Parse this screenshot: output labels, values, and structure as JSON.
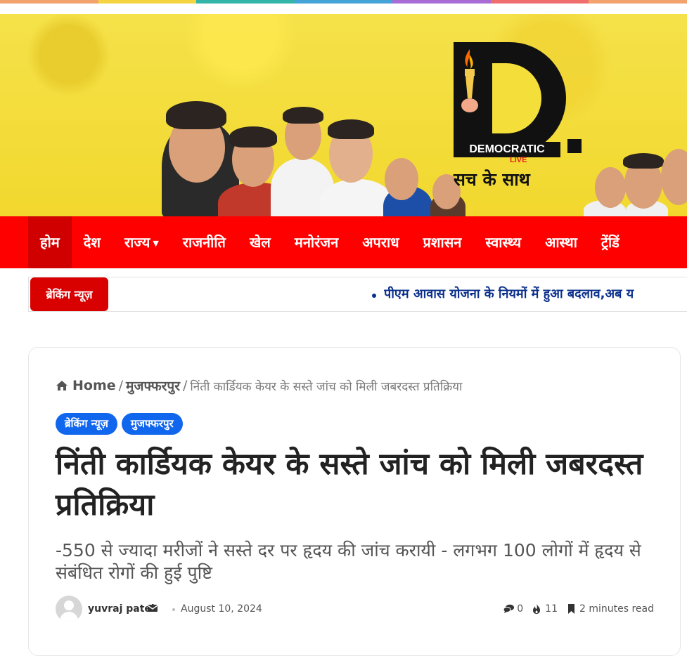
{
  "colors": {
    "top_strip": [
      "#f2a36d",
      "#f5d442",
      "#33b5a8",
      "#45a3d8",
      "#a86cd6",
      "#ef6d6d",
      "#f2a36d"
    ],
    "nav_bg": "#ff0000",
    "breaking_bg": "#d90000",
    "tag_bg": "#1166ee",
    "ticker_text": "#0a2f8c"
  },
  "logo": {
    "brand": "DEMOCRATIC",
    "sub": "LIVE",
    "tagline": "सच के साथ"
  },
  "nav": {
    "items": [
      {
        "label": "होम",
        "active": true
      },
      {
        "label": "देश"
      },
      {
        "label": "राज्य",
        "dropdown": true
      },
      {
        "label": "राजनीति"
      },
      {
        "label": "खेल"
      },
      {
        "label": "मनोरंजन"
      },
      {
        "label": "अपराध"
      },
      {
        "label": "प्रशासन"
      },
      {
        "label": "स्वास्थ्य"
      },
      {
        "label": "आस्था"
      },
      {
        "label": "ट्रेंडिं"
      }
    ]
  },
  "ticker": {
    "label": "ब्रेकिंग न्यूज़",
    "headline": "पीएम आवास योजना के नियमों में हुआ बदलाव,अब य"
  },
  "breadcrumb": {
    "home": "Home",
    "category": "मुजफ्फरपुर",
    "current": "निंती कार्डियक केयर के सस्ते जांच को मिली जबरदस्त प्रतिक्रिया"
  },
  "tags": [
    "ब्रेकिंग न्यूज़",
    "मुजफ्फरपुर"
  ],
  "article": {
    "title": "निंती कार्डियक केयर के सस्ते जांच को मिली जबरदस्त प्रतिक्रिया",
    "subtitle": "-550 से ज्यादा मरीजों ने सस्ते दर पर हृदय की जांच करायी - लगभग 100 लोगों में हृदय से संबंधित रोगों की हुई पुष्टि"
  },
  "meta": {
    "author": "yuvraj patel",
    "date": "August 10, 2024",
    "comments": "0",
    "views": "11",
    "read_time": "2 minutes read"
  }
}
